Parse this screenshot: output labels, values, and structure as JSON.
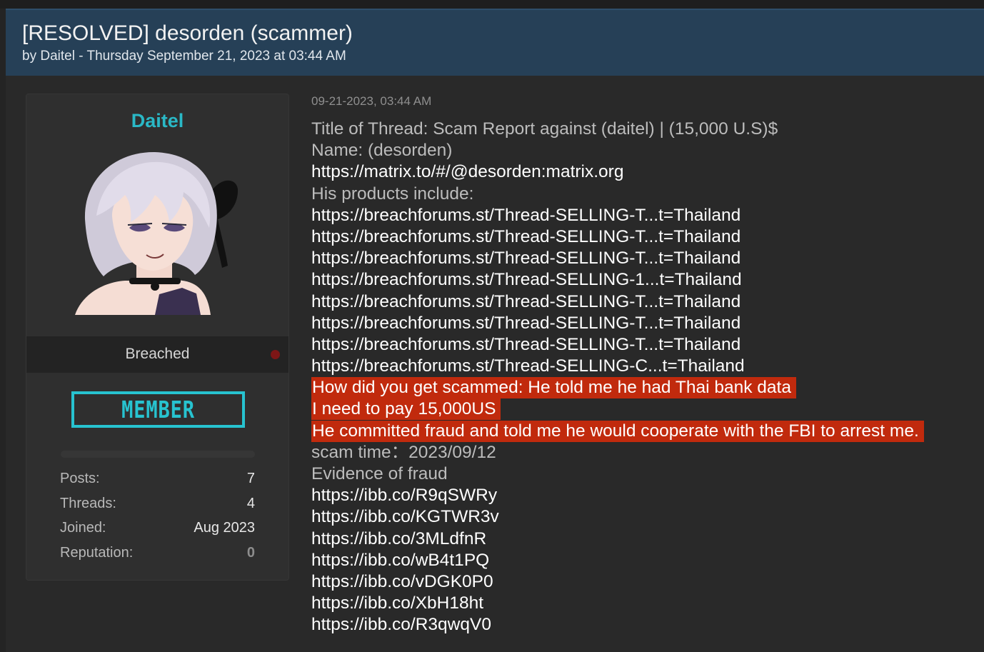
{
  "thread": {
    "title": "[RESOLVED] desorden (scammer)",
    "byline": "by Daitel - Thursday September 21, 2023 at 03:44 AM"
  },
  "user": {
    "username": "Daitel",
    "usergroup": "Breached",
    "badge": "MEMBER",
    "stats": {
      "posts_label": "Posts:",
      "posts": "7",
      "threads_label": "Threads:",
      "threads": "4",
      "joined_label": "Joined:",
      "joined": "Aug 2023",
      "reputation_label": "Reputation:",
      "reputation": "0"
    },
    "status_color": "#7d1616",
    "name_color": "#2ab8c6"
  },
  "post": {
    "date": "09-21-2023, 03:44 AM",
    "lines": [
      {
        "text": "Title of Thread: Scam Report against (daitel) | (15,000 U.S)$",
        "kind": "plain"
      },
      {
        "text": "Name: (desorden)",
        "kind": "plain"
      },
      {
        "text": "https://matrix.to/#/@desorden:matrix.org",
        "kind": "link"
      },
      {
        "text": "His products include:",
        "kind": "plain"
      },
      {
        "text": "https://breachforums.st/Thread-SELLING-T...t=Thailand",
        "kind": "link"
      },
      {
        "text": "https://breachforums.st/Thread-SELLING-T...t=Thailand",
        "kind": "link"
      },
      {
        "text": "https://breachforums.st/Thread-SELLING-T...t=Thailand",
        "kind": "link"
      },
      {
        "text": "https://breachforums.st/Thread-SELLING-1...t=Thailand",
        "kind": "link"
      },
      {
        "text": "https://breachforums.st/Thread-SELLING-T...t=Thailand",
        "kind": "link"
      },
      {
        "text": "https://breachforums.st/Thread-SELLING-T...t=Thailand",
        "kind": "link"
      },
      {
        "text": "https://breachforums.st/Thread-SELLING-T...t=Thailand",
        "kind": "link"
      },
      {
        "text": "https://breachforums.st/Thread-SELLING-C...t=Thailand",
        "kind": "link"
      },
      {
        "text": "How did you get scammed: He told me he had Thai bank data",
        "kind": "highlight"
      },
      {
        "text": "I need to pay 15,000US",
        "kind": "highlight"
      },
      {
        "text": "He committed fraud and told me he would cooperate with the FBI to arrest me.",
        "kind": "highlight"
      },
      {
        "text": "scam time：2023/09/12",
        "kind": "plain"
      },
      {
        "text": "Evidence of fraud",
        "kind": "plain"
      },
      {
        "text": "https://ibb.co/R9qSWRy",
        "kind": "link"
      },
      {
        "text": "https://ibb.co/KGTWR3v",
        "kind": "link"
      },
      {
        "text": "https://ibb.co/3MLdfnR",
        "kind": "link"
      },
      {
        "text": "https://ibb.co/wB4t1PQ",
        "kind": "link"
      },
      {
        "text": "https://ibb.co/vDGK0P0",
        "kind": "link"
      },
      {
        "text": "https://ibb.co/XbH18ht",
        "kind": "link"
      },
      {
        "text": "https://ibb.co/R3qwqV0",
        "kind": "link"
      }
    ],
    "highlight_color": "#c12a0d"
  }
}
